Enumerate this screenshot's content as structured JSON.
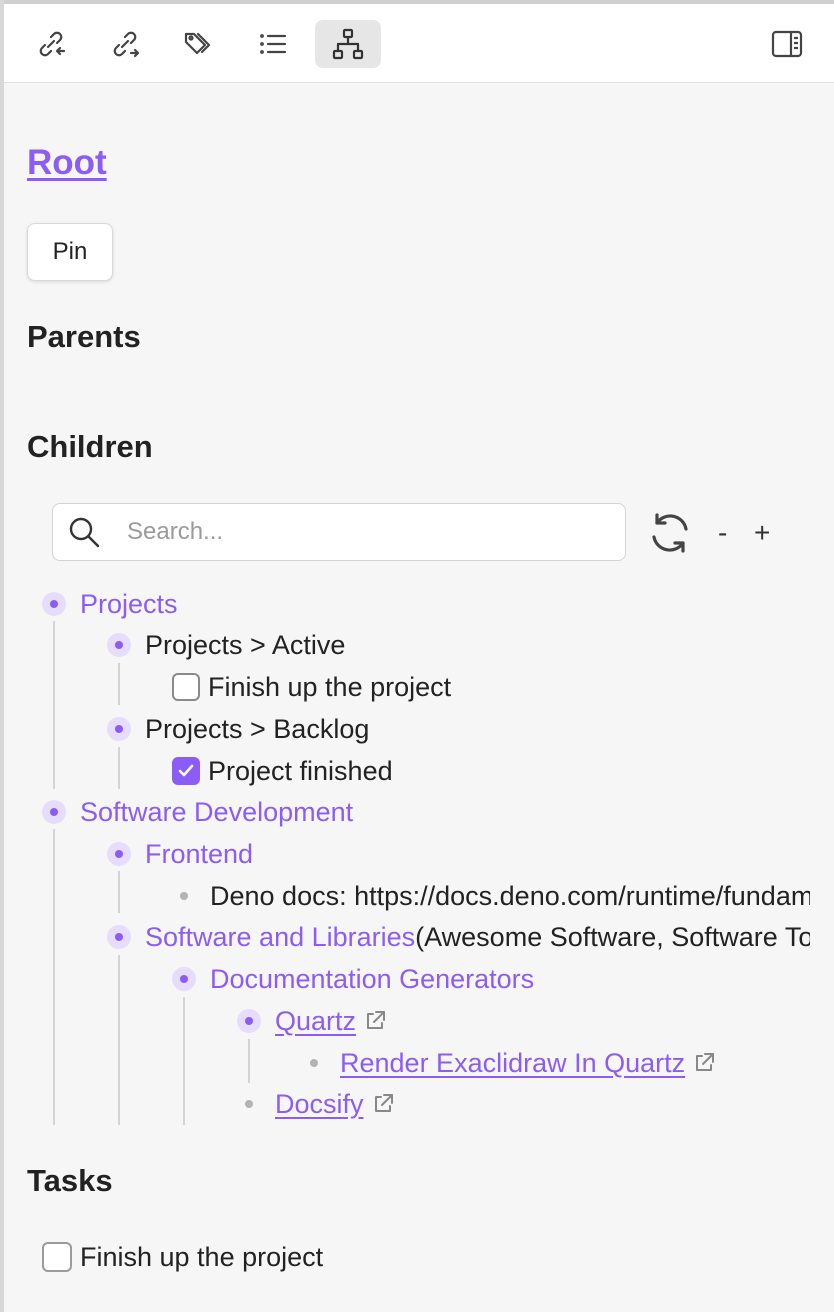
{
  "toolbar": {
    "buttons": [
      {
        "icon": "backlinks-icon"
      },
      {
        "icon": "outgoing-links-icon"
      },
      {
        "icon": "tags-icon"
      },
      {
        "icon": "outline-list-icon"
      },
      {
        "icon": "hierarchy-icon",
        "active": true
      }
    ],
    "right_icon": "sidebar-toggle-icon"
  },
  "root_title": "Root",
  "pin_label": "Pin",
  "sections": {
    "parents": "Parents",
    "children": "Children",
    "tasks": "Tasks"
  },
  "search": {
    "placeholder": "Search...",
    "value": ""
  },
  "controls": {
    "collapse": "-",
    "expand": "+"
  },
  "tree": [
    {
      "label": "Projects",
      "style": "purple"
    },
    {
      "label": "Projects > Active",
      "style": "plain"
    },
    {
      "label": "Finish up the project",
      "checkbox": false
    },
    {
      "label": "Projects > Backlog",
      "style": "plain"
    },
    {
      "label": "Project finished",
      "checkbox": true
    },
    {
      "label": "Software Development",
      "style": "purple"
    },
    {
      "label": "Frontend",
      "style": "purple"
    },
    {
      "label": "Deno docs: https://docs.deno.com/runtime/fundamentals/",
      "style": "plain"
    },
    {
      "label": "Software and Libraries",
      "suffix": "(Awesome Software, Software Tools)",
      "style": "purple"
    },
    {
      "label": "Documentation Generators",
      "style": "purple"
    },
    {
      "label": "Quartz",
      "style": "link"
    },
    {
      "label": "Render Exaclidraw In Quartz",
      "style": "link"
    },
    {
      "label": "Docsify",
      "style": "link"
    }
  ],
  "tasks": [
    {
      "label": "Finish up the project",
      "checked": false
    }
  ],
  "colors": {
    "accent": "#8b5cf6",
    "accent_light": "#e6dcfb",
    "background": "#f6f6f6"
  }
}
